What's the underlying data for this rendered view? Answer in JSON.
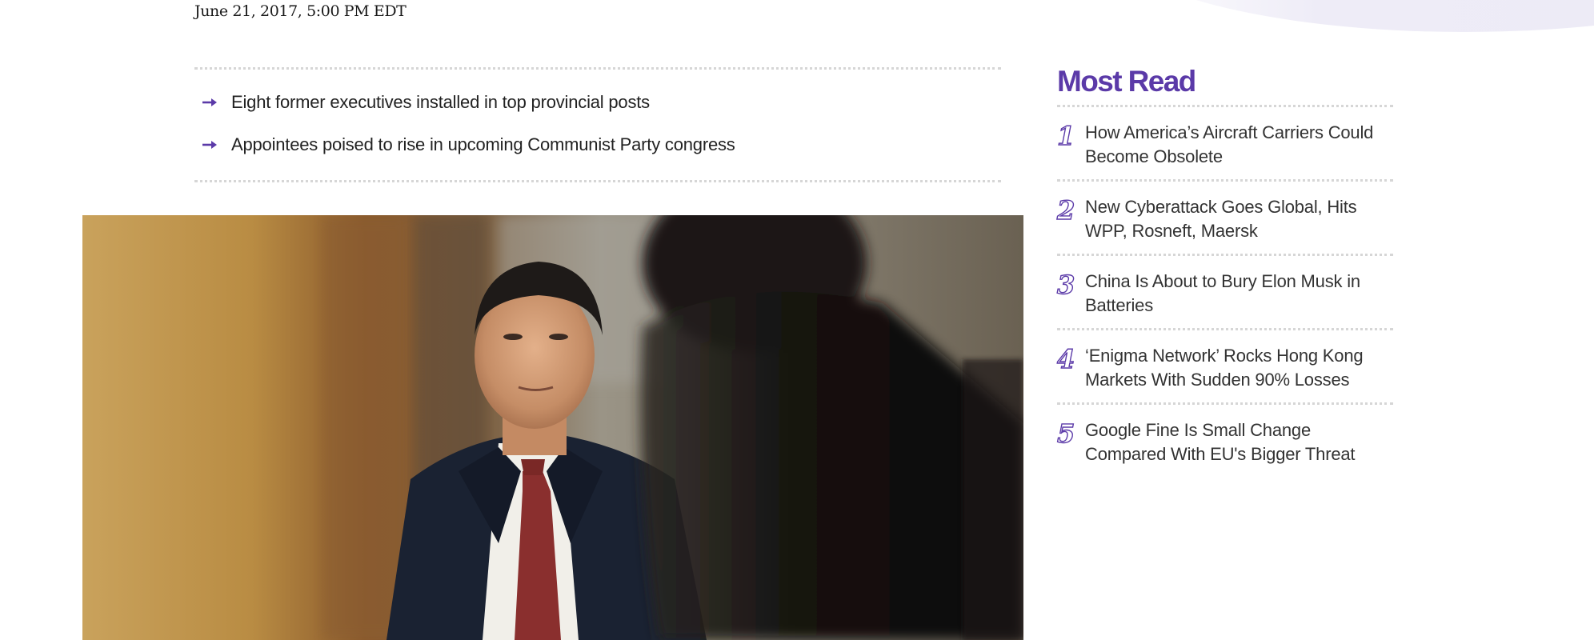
{
  "article": {
    "dateline": "June 21, 2017, 5:00 PM EDT",
    "summary": [
      "Eight former executives installed in top provincial posts",
      "Appointees poised to rise in upcoming Communist Party congress"
    ]
  },
  "most_read": {
    "title": "Most Read",
    "items": [
      {
        "rank": "1",
        "headline": "How America’s Aircraft Carriers Could Become Obsolete"
      },
      {
        "rank": "2",
        "headline": "New Cyberattack Goes Global, Hits WPP, Rosneft, Maersk"
      },
      {
        "rank": "3",
        "headline": "China Is About to Bury Elon Musk in Batteries"
      },
      {
        "rank": "4",
        "headline": "‘Enigma Network’ Rocks Hong Kong Markets With Sudden 90% Losses"
      },
      {
        "rank": "5",
        "headline": "Google Fine Is Small Change Compared With EU's Bigger Threat"
      }
    ]
  },
  "colors": {
    "accent": "#5b3aa8",
    "divider": "#d6d6d6",
    "text": "#222222"
  },
  "icons": {
    "summary_bullet": "arrow-right-icon"
  }
}
